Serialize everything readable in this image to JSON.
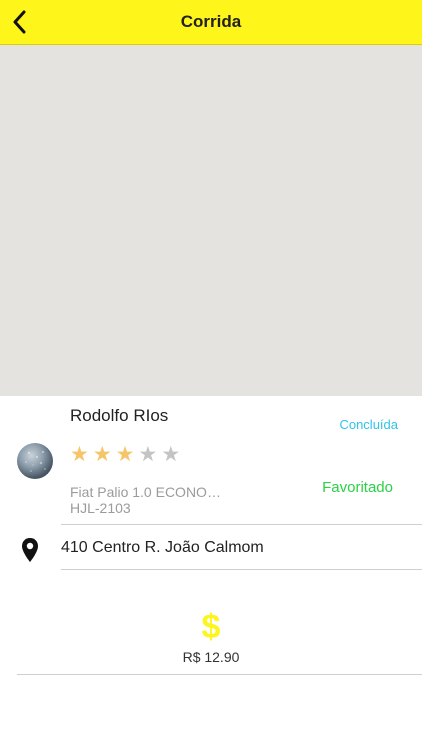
{
  "header": {
    "title": "Corrida",
    "back_icon": "chevron-left-icon",
    "background": "#fef51a"
  },
  "map": {
    "background": "#e5e3df"
  },
  "driver": {
    "name": "Rodolfo RIos",
    "status": "Concluída",
    "status_color": "#2ec4e8",
    "rating": 3,
    "rating_max": 5,
    "favorite_label": "Favoritado",
    "favorite_color": "#2bd146",
    "car": "Fiat Palio 1.0 ECONO…",
    "plate": "HJL-2103"
  },
  "address": {
    "icon": "map-pin-icon",
    "text": "410 Centro R. João Calmom"
  },
  "price": {
    "symbol": "$",
    "amount": "R$ 12.90"
  }
}
